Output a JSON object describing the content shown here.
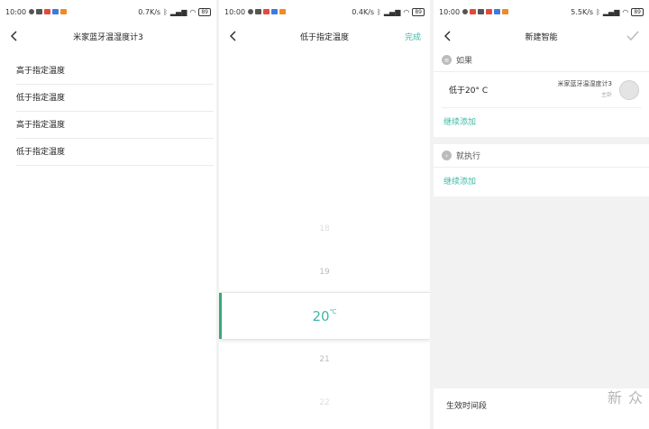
{
  "screens": [
    {
      "status": {
        "time": "10:00",
        "speed": "0.7K/s",
        "battery": "89"
      },
      "title": "米家蓝牙温湿度计3",
      "conditions": [
        "高于指定温度",
        "低于指定温度",
        "高于指定温度",
        "低于指定温度"
      ]
    },
    {
      "status": {
        "time": "10:00",
        "speed": "0.4K/s",
        "battery": "89"
      },
      "title": "低于指定温度",
      "done_label": "完成",
      "picker": {
        "values": [
          "18",
          "19",
          "21",
          "22"
        ],
        "selected": "20",
        "unit": "℃"
      }
    },
    {
      "status": {
        "time": "10:00",
        "speed": "5.5K/s",
        "battery": "89"
      },
      "title": "新建智能",
      "if_section": {
        "header": "如果",
        "condition": "低于20° C",
        "device_name": "米家蓝牙温湿度计3",
        "device_room": "主卧",
        "add_label": "继续添加"
      },
      "then_section": {
        "header": "就执行",
        "add_label": "继续添加"
      },
      "effective_period": "生效时间段",
      "watermark": "新 众"
    }
  ],
  "colors": {
    "accent": "#3fb8a7",
    "picker_bar": "#3aa876"
  }
}
